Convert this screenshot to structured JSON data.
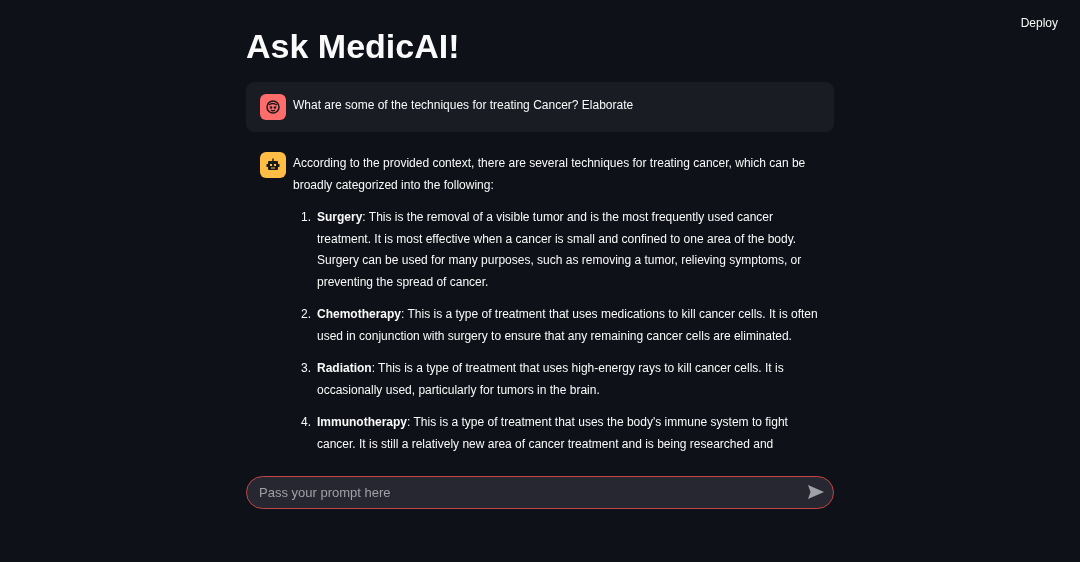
{
  "header": {
    "deploy": "Deploy"
  },
  "title": "Ask MedicAI!",
  "messages": [
    {
      "kind": "user",
      "text": "What are some of the techniques for treating Cancer? Elaborate"
    },
    {
      "kind": "assistant",
      "text": "According to the provided context, there are several techniques for treating cancer, which can be broadly categorized into the following:",
      "items": [
        {
          "number": "1.",
          "text": "**Surgery**: This is the removal of a visible tumor and is the most frequently used cancer treatment. It is most effective when a cancer is small and confined to one area of the body. Surgery can be used for many purposes, such as removing a tumor, relieving symptoms, or preventing the spread of cancer."
        },
        {
          "number": "2.",
          "text": "**Chemotherapy**: This is a type of treatment that uses medications to kill cancer cells. It is often used in conjunction with surgery to ensure that any remaining cancer cells are eliminated."
        },
        {
          "number": "3.",
          "text": "**Radiation**: This is a type of treatment that uses high-energy rays to kill cancer cells. It is occasionally used, particularly for tumors in the brain."
        },
        {
          "number": "4.",
          "text": "**Immunotherapy**: This is a type of treatment that uses the body's immune system to fight cancer. It is still a relatively new area of cancer treatment and is being researched and"
        }
      ]
    }
  ],
  "prompt": {
    "placeholder": "Pass your prompt here"
  }
}
